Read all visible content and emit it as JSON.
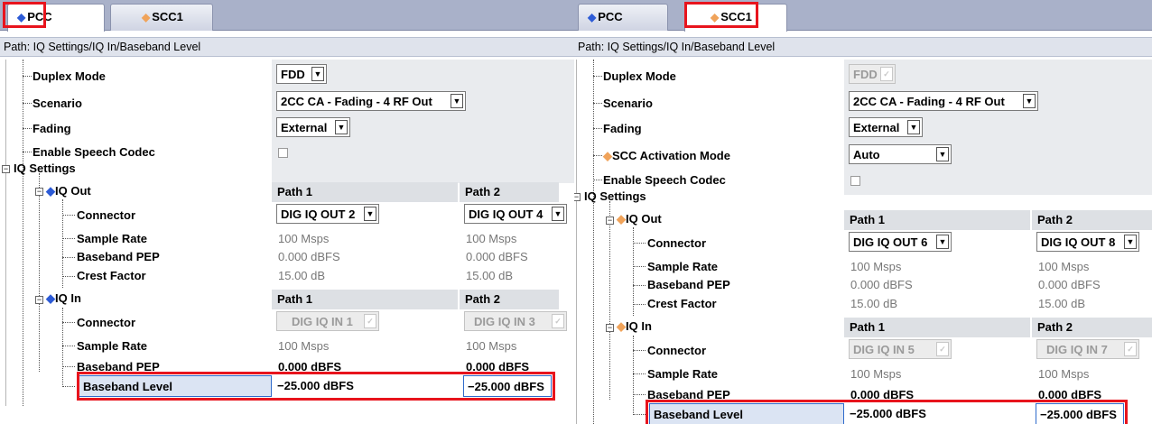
{
  "left": {
    "tabs": [
      {
        "label": "PCC",
        "diamond_color": "#2d5bd6",
        "active": true
      },
      {
        "label": "SCC1",
        "diamond_color": "#f0a35a",
        "active": false
      }
    ],
    "path_text": "Path: IQ Settings/IQ In/Baseband Level",
    "rows": {
      "duplex_mode": {
        "label": "Duplex Mode",
        "value": "FDD"
      },
      "scenario": {
        "label": "Scenario",
        "value": "2CC CA - Fading - 4 RF Out"
      },
      "fading": {
        "label": "Fading",
        "value": "External"
      },
      "speech_codec": {
        "label": "Enable Speech Codec"
      },
      "iq_settings": {
        "label": "IQ Settings"
      }
    },
    "iq_out": {
      "label": "IQ Out",
      "path1_header": "Path 1",
      "path2_header": "Path 2",
      "connector": {
        "label": "Connector",
        "path1": "DIG IQ OUT 2",
        "path2": "DIG IQ OUT 4"
      },
      "sample_rate": {
        "label": "Sample Rate",
        "path1": "100 Msps",
        "path2": "100 Msps"
      },
      "baseband_pep": {
        "label": "Baseband PEP",
        "path1": "0.000  dBFS",
        "path2": "0.000  dBFS"
      },
      "crest_factor": {
        "label": "Crest Factor",
        "path1": "15.00 dB",
        "path2": "15.00 dB"
      }
    },
    "iq_in": {
      "label": "IQ In",
      "path1_header": "Path 1",
      "path2_header": "Path 2",
      "connector": {
        "label": "Connector",
        "path1": "DIG IQ IN 1",
        "path2": "DIG IQ IN 3"
      },
      "sample_rate": {
        "label": "Sample Rate",
        "path1": "100 Msps",
        "path2": "100 Msps"
      },
      "baseband_pep": {
        "label": "Baseband PEP",
        "path1": "0.000  dBFS",
        "path2": "0.000  dBFS"
      },
      "baseband_level": {
        "label": "Baseband Level",
        "path1": "−25.000  dBFS",
        "path2": "−25.000  dBFS"
      }
    }
  },
  "right": {
    "tabs": [
      {
        "label": "PCC",
        "diamond_color": "#2d5bd6",
        "active": false
      },
      {
        "label": "SCC1",
        "diamond_color": "#f0a35a",
        "active": true
      }
    ],
    "path_text": "Path: IQ Settings/IQ In/Baseband Level",
    "rows": {
      "duplex_mode": {
        "label": "Duplex Mode",
        "value": "FDD"
      },
      "scenario": {
        "label": "Scenario",
        "value": "2CC CA - Fading - 4 RF Out"
      },
      "fading": {
        "label": "Fading",
        "value": "External"
      },
      "scc_activation": {
        "label": "SCC Activation Mode",
        "value": "Auto"
      },
      "speech_codec": {
        "label": "Enable Speech Codec"
      },
      "iq_settings": {
        "label": "IQ Settings"
      }
    },
    "iq_out": {
      "label": "IQ Out",
      "path1_header": "Path 1",
      "path2_header": "Path 2",
      "connector": {
        "label": "Connector",
        "path1": "DIG IQ OUT 6",
        "path2": "DIG IQ OUT 8"
      },
      "sample_rate": {
        "label": "Sample Rate",
        "path1": "100 Msps",
        "path2": "100 Msps"
      },
      "baseband_pep": {
        "label": "Baseband PEP",
        "path1": "0.000  dBFS",
        "path2": "0.000  dBFS"
      },
      "crest_factor": {
        "label": "Crest Factor",
        "path1": "15.00 dB",
        "path2": "15.00 dB"
      }
    },
    "iq_in": {
      "label": "IQ In",
      "path1_header": "Path 1",
      "path2_header": "Path 2",
      "connector": {
        "label": "Connector",
        "path1": "DIG IQ IN 5",
        "path2": "DIG IQ IN 7"
      },
      "sample_rate": {
        "label": "Sample Rate",
        "path1": "100 Msps",
        "path2": "100 Msps"
      },
      "baseband_pep": {
        "label": "Baseband PEP",
        "path1": "0.000  dBFS",
        "path2": "0.000  dBFS"
      },
      "baseband_level": {
        "label": "Baseband Level",
        "path1": "−25.000  dBFS",
        "path2": "−25.000  dBFS"
      }
    }
  },
  "colors": {
    "highlight": "#e8141d",
    "pcc_diamond": "#2d5bd6",
    "scc_diamond": "#f0a35a",
    "focus_blue": "#2f6bcc"
  }
}
